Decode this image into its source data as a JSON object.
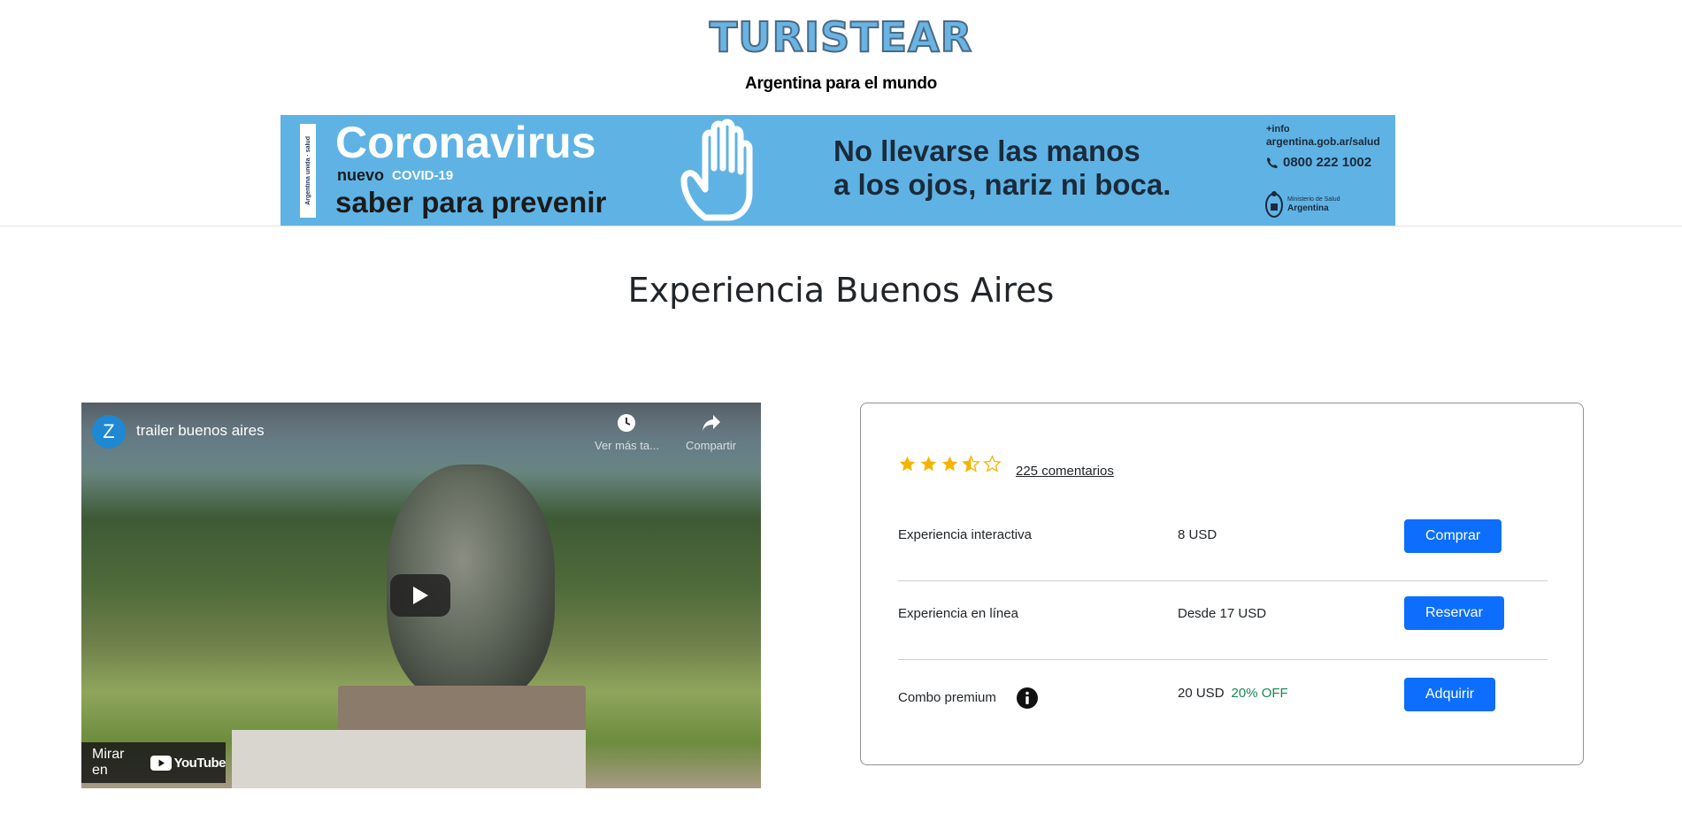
{
  "header": {
    "logo": "TURISTEAR",
    "tagline": "Argentina para el mundo"
  },
  "banner": {
    "ministry_strip": "Argentina unida · salud",
    "title": "Coronavirus",
    "nuevo": "nuevo",
    "covid": "COVID-19",
    "slogan": "saber para prevenir",
    "message": "No llevarse las manos\na los ojos, nariz ni boca.",
    "info_label": "+info",
    "info_url": "argentina.gob.ar/salud",
    "phone": "0800 222 1002",
    "ministry_small": "Ministerio de Salud",
    "ministry_country": "Argentina",
    "bg_color": "#5fb3e4"
  },
  "main": {
    "title": "Experiencia Buenos Aires"
  },
  "video": {
    "channel_initial": "Z",
    "title": "trailer buenos aires",
    "watch_later": "Ver más ta...",
    "share": "Compartir",
    "watch_on": "Mirar en",
    "youtube": "YouTube"
  },
  "offer": {
    "rating": 3.5,
    "rating_max": 5,
    "comments": " 225 comentarios",
    "rows": [
      {
        "name": "Experiencia interactiva",
        "price": "8 USD",
        "discount": "",
        "button": "Comprar"
      },
      {
        "name": "Experiencia en línea",
        "price": "Desde 17 USD",
        "discount": "",
        "button": "Reservar"
      },
      {
        "name": "Combo premium",
        "price": "20 USD",
        "discount": "20% OFF",
        "button": "Adquirir"
      }
    ],
    "button_color": "#0d6efd",
    "star_color": "#f5b301",
    "discount_color": "#198754"
  }
}
